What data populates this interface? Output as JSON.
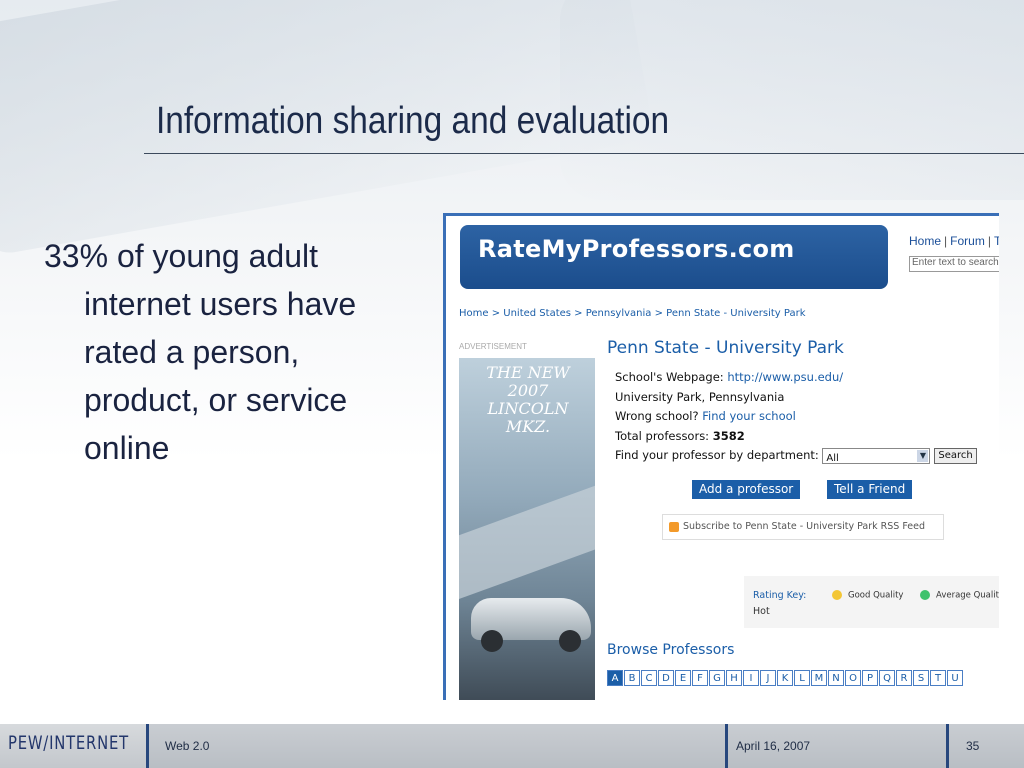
{
  "slide": {
    "title": "Information sharing and evaluation",
    "bullet": "33% of young adult internet users have rated a person, product, or service online"
  },
  "screenshot": {
    "logo": "RateMyProfessors.com",
    "topnav": {
      "home": "Home",
      "forum": "Forum",
      "more": "T",
      "search_placeholder": "Enter text to search"
    },
    "breadcrumb": "Home > United States > Pennsylvania > Penn State - University Park",
    "ad_label": "ADVERTISEMENT",
    "ad_text": "THE NEW 2007 LINCOLN MKZ.",
    "school": {
      "name": "Penn State - University Park",
      "webpage_label": "School's Webpage:",
      "webpage_url": "http://www.psu.edu/",
      "location": "University Park, Pennsylvania",
      "wrong_school_label": "Wrong school?",
      "find_school_link": "Find your school",
      "total_label": "Total professors:",
      "total_value": "3582",
      "dept_label": "Find your professor by department:",
      "dept_selected": "All",
      "search_button": "Search"
    },
    "buttons": {
      "add_professor": "Add a professor",
      "tell_friend": "Tell a Friend"
    },
    "rss": "Subscribe to Penn State - University Park RSS Feed",
    "rating_key": {
      "label": "Rating Key:",
      "good": "Good Quality",
      "average": "Average Quality",
      "hot": "Hot"
    },
    "browse": {
      "heading": "Browse Professors",
      "letters": [
        "A",
        "B",
        "C",
        "D",
        "E",
        "F",
        "G",
        "H",
        "I",
        "J",
        "K",
        "L",
        "M",
        "N",
        "O",
        "P",
        "Q",
        "R",
        "S",
        "T",
        "U"
      ]
    }
  },
  "footer": {
    "brand": "PEW/INTERNET",
    "topic": "Web 2.0",
    "date": "April 16, 2007",
    "page": "35"
  }
}
